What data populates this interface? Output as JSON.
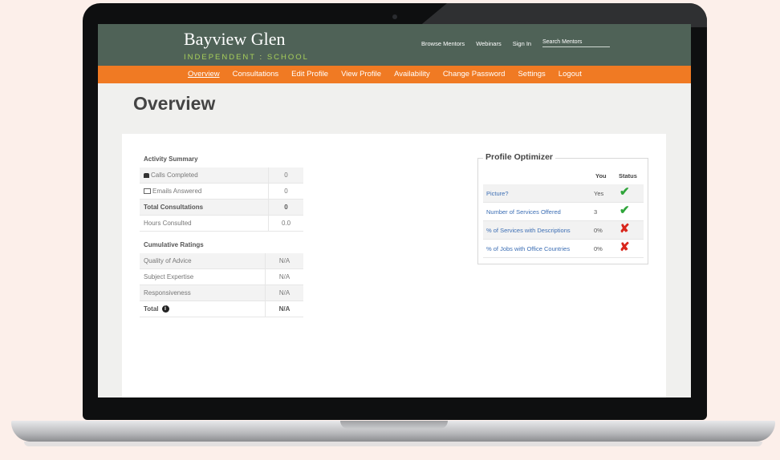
{
  "header": {
    "logo_main": "Bayview Glen",
    "logo_sub_a": "INDEPENDENT",
    "logo_sub_sep": " : ",
    "logo_sub_b": "SCHOOL",
    "links": [
      "Browse Mentors",
      "Webinars",
      "Sign In"
    ],
    "search_placeholder": "Search Mentors"
  },
  "nav": [
    "Overview",
    "Consultations",
    "Edit Profile",
    "View Profile",
    "Availability",
    "Change Password",
    "Settings",
    "Logout"
  ],
  "page_title": "Overview",
  "activity": {
    "title": "Activity Summary",
    "rows": [
      {
        "label": "Calls Completed",
        "value": "0"
      },
      {
        "label": "Emails Answered",
        "value": "0"
      },
      {
        "label": "Total Consultations",
        "value": "0"
      },
      {
        "label": "Hours Consulted",
        "value": "0.0"
      }
    ]
  },
  "ratings": {
    "title": "Cumulative Ratings",
    "rows": [
      {
        "label": "Quality of Advice",
        "value": "N/A"
      },
      {
        "label": "Subject Expertise",
        "value": "N/A"
      },
      {
        "label": "Responsiveness",
        "value": "N/A"
      },
      {
        "label": "Total",
        "value": "N/A"
      }
    ]
  },
  "optimizer": {
    "title": "Profile Optimizer",
    "col_you": "You",
    "col_status": "Status",
    "rows": [
      {
        "label": "Picture?",
        "you": "Yes",
        "status": "✔"
      },
      {
        "label": "Number of Services Offered",
        "you": "3",
        "status": "✔"
      },
      {
        "label": "% of Services with Descriptions",
        "you": "0%",
        "status": "✘"
      },
      {
        "label": "% of Jobs with Office Countries",
        "you": "0%",
        "status": "✘"
      }
    ]
  },
  "colors": {
    "header": "#4f6257",
    "nav": "#f07a23",
    "ok": "#2fa53a",
    "bad": "#d9261c",
    "link": "#3c6eb4"
  }
}
